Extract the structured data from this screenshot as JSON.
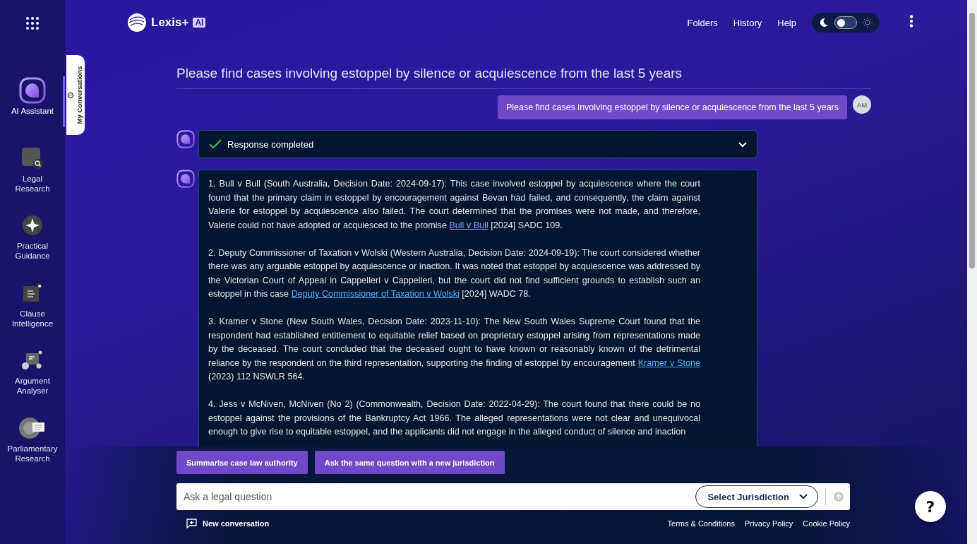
{
  "rail": {
    "items": [
      {
        "label": "AI Assistant",
        "kind": "assistant",
        "selected": true
      },
      {
        "label": "Legal Research",
        "kind": "research",
        "selected": false
      },
      {
        "label": "Practical Guidance",
        "kind": "guidance",
        "selected": false
      },
      {
        "label": "Clause Intelligence",
        "kind": "clause",
        "selected": false
      },
      {
        "label": "Argument Analyser",
        "kind": "argument",
        "selected": false
      },
      {
        "label": "Parliamentary Research",
        "kind": "parliament",
        "selected": false
      }
    ],
    "drawer_tab": "My Conversations"
  },
  "header": {
    "logo": "Lexis+",
    "logo_badge": "AI",
    "nav": [
      "Folders",
      "History",
      "Help"
    ],
    "theme_toggle": {
      "on": false
    }
  },
  "conversation": {
    "title": "Please find cases involving estoppel by silence or acquiescence from the last 5 years",
    "user_message": "Please find cases involving estoppel by silence or acquiescence from the last 5 years",
    "user_initials": "AM",
    "status": {
      "label": "Response completed",
      "expanded": false
    },
    "answer": [
      {
        "text": "1. Bull v Bull (South Australia, Decision Date: 2024-09-17): This case involved estoppel by acquiescence where the court found that the primary claim in estoppel by encouragement against Bevan had failed, and consequently, the claim against Valerie for estoppel by acquiescence also failed. The court determined that the promises were not made, and therefore, Valerie could not have adopted or acquiesced to the promise ",
        "link": "Bull v Bull",
        "citation": " [2024] SADC 109."
      },
      {
        "text": "2. Deputy Commissioner of Taxation v Wolski (Western Australia, Decision Date: 2024-09-19): The court considered whether there was any arguable estoppel by acquiescence or inaction. It was noted that estoppel by acquiescence was addressed by the Victorian Court of Appeal in Cappelleri v Cappelleri, but the court did not find sufficient grounds to establish such an estoppel in this case ",
        "link": "Deputy Commissioner of Taxation v Wolski",
        "citation": " [2024] WADC 78."
      },
      {
        "text": "3. Kramer v Stone (New South Wales, Decision Date: 2023-11-10): The New South Wales Supreme Court found that the respondent had established entitlement to equitable relief based on proprietary estoppel arising from representations made by the deceased. The court concluded that the deceased ought to have known or reasonably known of the detrimental reliance by the respondent on the third representation, supporting the finding of estoppel by encouragement ",
        "link": "Kramer v Stone",
        "citation": " (2023) 112 NSWLR 564."
      },
      {
        "text": "4. Jess v McNiven, McNiven (No 2) (Commonwealth, Decision Date: 2022-04-29): The court found that there could be no estoppel against the provisions of the Bankruptcy Act 1966. The alleged representations were not clear and unequivocal enough to give rise to equitable estoppel, and the applicants did not engage in the alleged conduct of silence and inaction"
      }
    ]
  },
  "suggestions": [
    "Summarise case law authority",
    "Ask the same question with a new jurisdiction"
  ],
  "composer": {
    "placeholder": "Ask a legal question",
    "jurisdiction": "Select Jurisdiction"
  },
  "footer": {
    "new_conversation": "New conversation",
    "links": [
      "Terms & Conditions",
      "Privacy Policy",
      "Cookie Policy"
    ]
  },
  "help_button": "?"
}
